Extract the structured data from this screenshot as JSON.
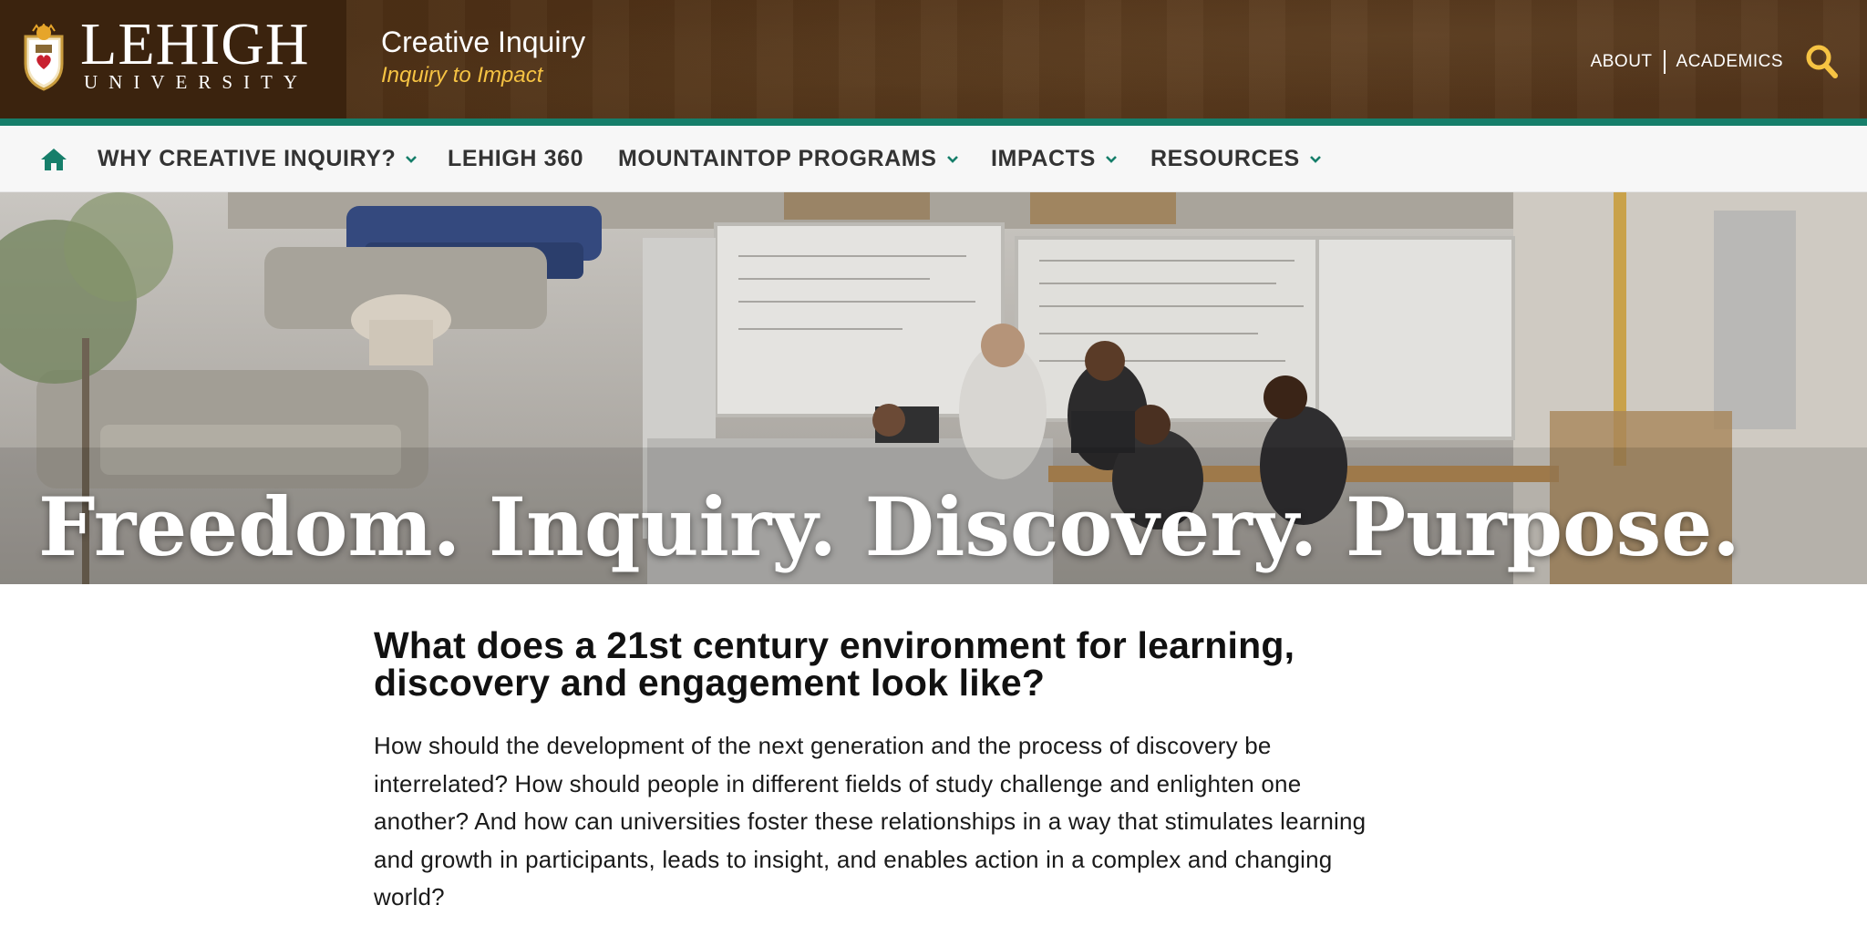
{
  "brand": {
    "name": "LEHIGH",
    "sub": "UNIVERSITY",
    "site_title": "Creative Inquiry",
    "tagline": "Inquiry to Impact"
  },
  "utility_nav": {
    "items": [
      "ABOUT",
      "ACADEMICS"
    ]
  },
  "main_nav": {
    "items": [
      {
        "label": "WHY CREATIVE INQUIRY?",
        "dropdown": true
      },
      {
        "label": "LEHIGH 360",
        "dropdown": false
      },
      {
        "label": "MOUNTAINTOP PROGRAMS",
        "dropdown": true
      },
      {
        "label": "IMPACTS",
        "dropdown": true
      },
      {
        "label": "RESOURCES",
        "dropdown": true
      }
    ]
  },
  "hero": {
    "heading": "Freedom. Inquiry. Discovery. Purpose."
  },
  "content": {
    "heading_line1": "What does a 21st century environment for learning,",
    "heading_line2": "discovery and engagement look like?",
    "paragraph_lines": [
      "How should the development of the next generation and the process of discovery be",
      "interrelated? How should people in different fields of study challenge and enlighten one",
      "another? And how can universities foster these relationships in a way that stimulates learning",
      "and growth in participants, leads to insight, and enables action in a complex and changing",
      "world?"
    ]
  },
  "colors": {
    "header_brown": "#4c2f15",
    "accent_teal": "#167e6a",
    "accent_gold": "#f6c343"
  },
  "icons": [
    "lehigh-shield-logo",
    "search-icon",
    "home-icon",
    "chevron-down-icon"
  ]
}
